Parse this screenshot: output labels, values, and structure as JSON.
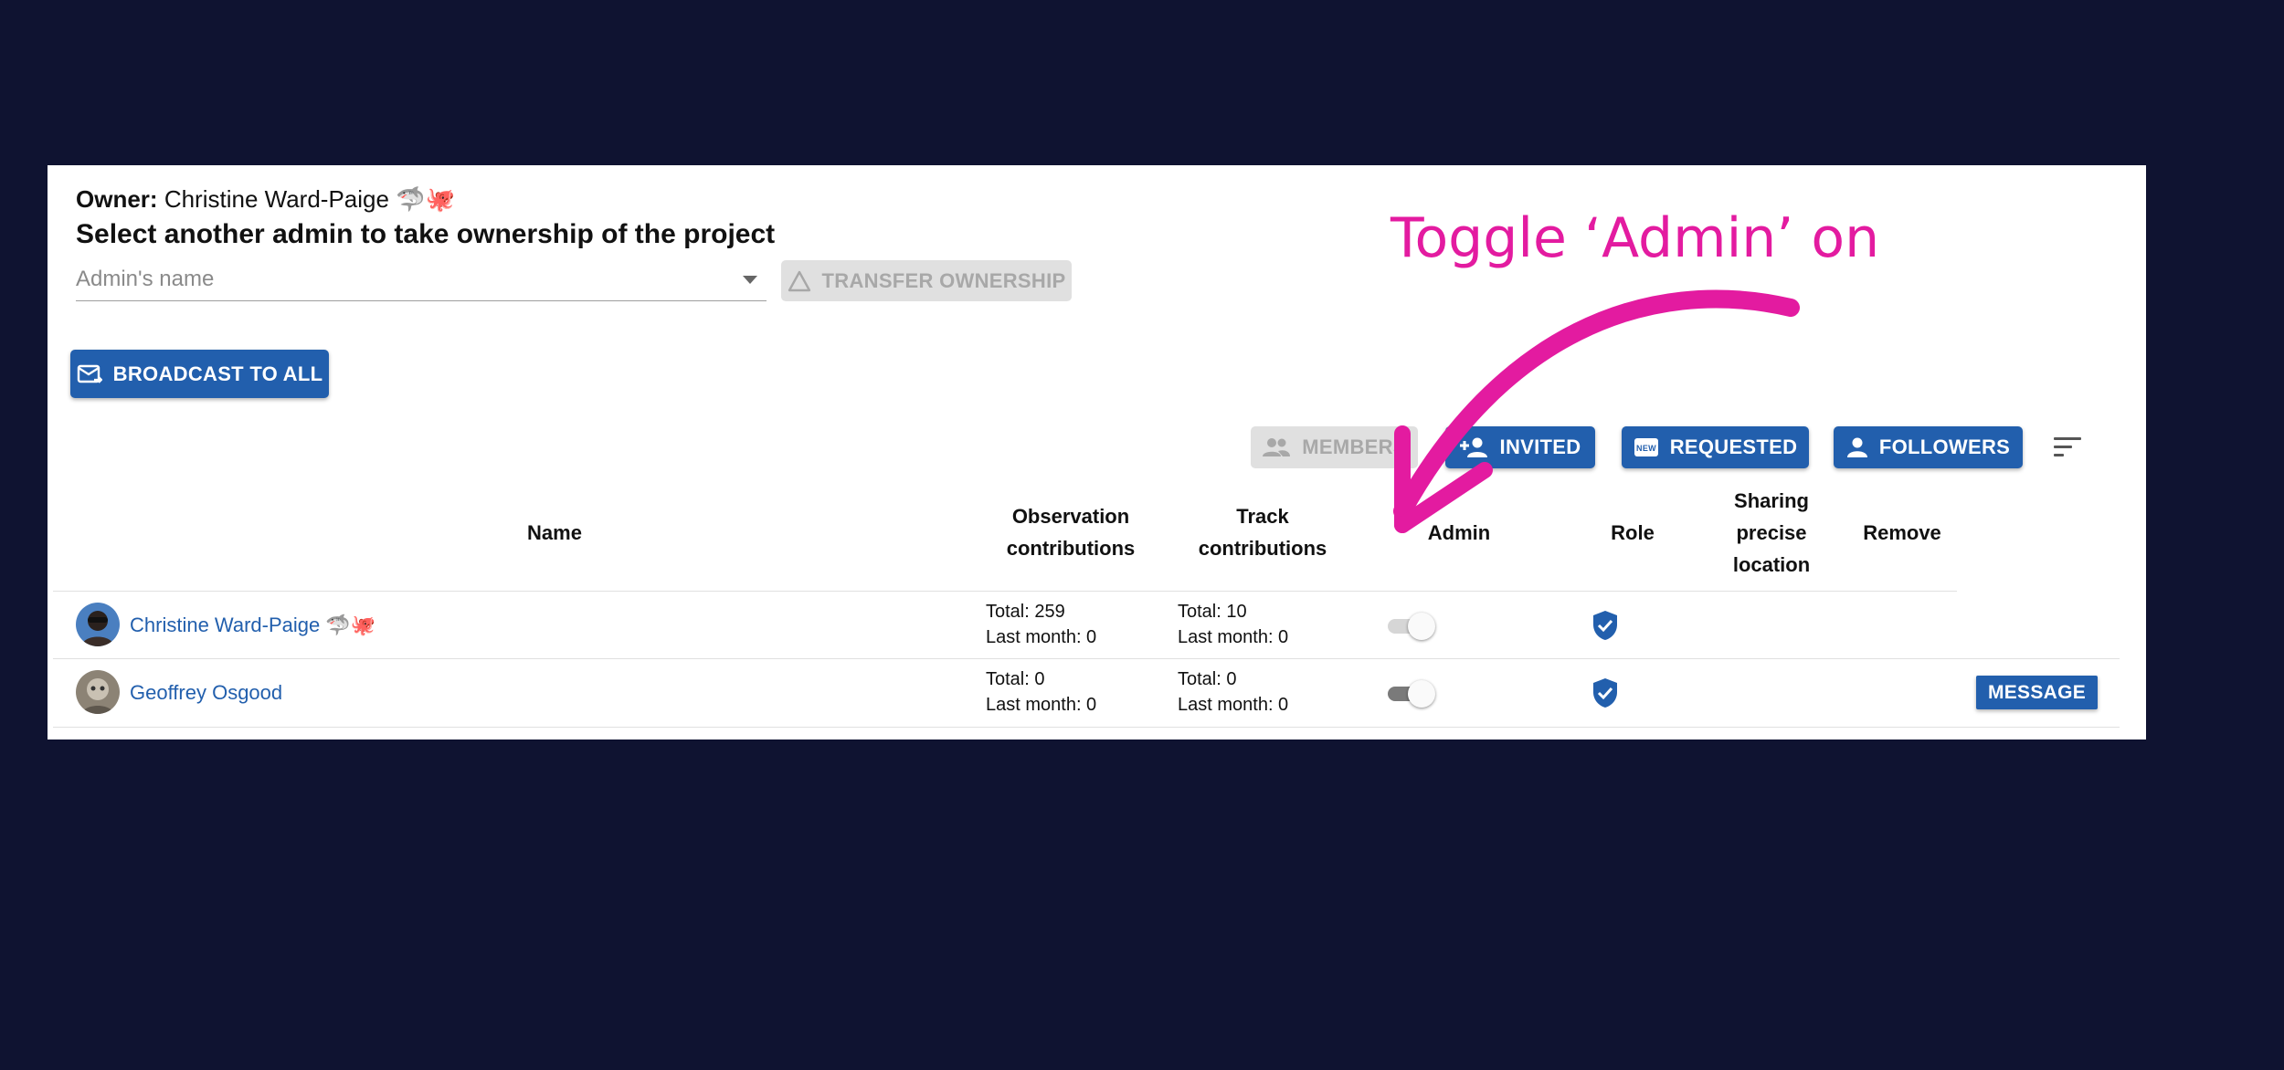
{
  "owner": {
    "label": "Owner:",
    "name": "Christine Ward-Paige 🦈🐙"
  },
  "transfer": {
    "title": "Select another admin to take ownership of the project",
    "placeholder": "Admin's name",
    "button_label": "TRANSFER OWNERSHIP"
  },
  "broadcast": {
    "label": "BROADCAST TO ALL"
  },
  "filters": [
    {
      "label": "MEMBERS",
      "state": "disabled"
    },
    {
      "label": "INVITED",
      "state": "active"
    },
    {
      "label": "REQUESTED",
      "state": "active"
    },
    {
      "label": "FOLLOWERS",
      "state": "active"
    }
  ],
  "table": {
    "columns": {
      "name": "Name",
      "observation": [
        "Observation",
        "contributions"
      ],
      "track": [
        "Track",
        "contributions"
      ],
      "admin": "Admin",
      "role": "Role",
      "sharing": [
        "Sharing",
        "precise",
        "location"
      ],
      "remove": "Remove"
    },
    "rows": [
      {
        "name": "Christine Ward-Paige 🦈🐙",
        "observation_total": "Total: 259",
        "observation_month": "Last month: 0",
        "track_total": "Total: 10",
        "track_month": "Last month: 0",
        "admin_on": false,
        "action": ""
      },
      {
        "name": "Geoffrey Osgood",
        "observation_total": "Total: 0",
        "observation_month": "Last month: 0",
        "track_total": "Total: 0",
        "track_month": "Last month: 0",
        "admin_on": false,
        "action": "MESSAGE"
      }
    ]
  },
  "annotation": {
    "text": "Toggle ‘Admin’ on"
  },
  "colors": {
    "accent": "#225fad",
    "background": "#0f1331",
    "annotation": "#e31ba0",
    "disabled": "#e0e0e0"
  }
}
